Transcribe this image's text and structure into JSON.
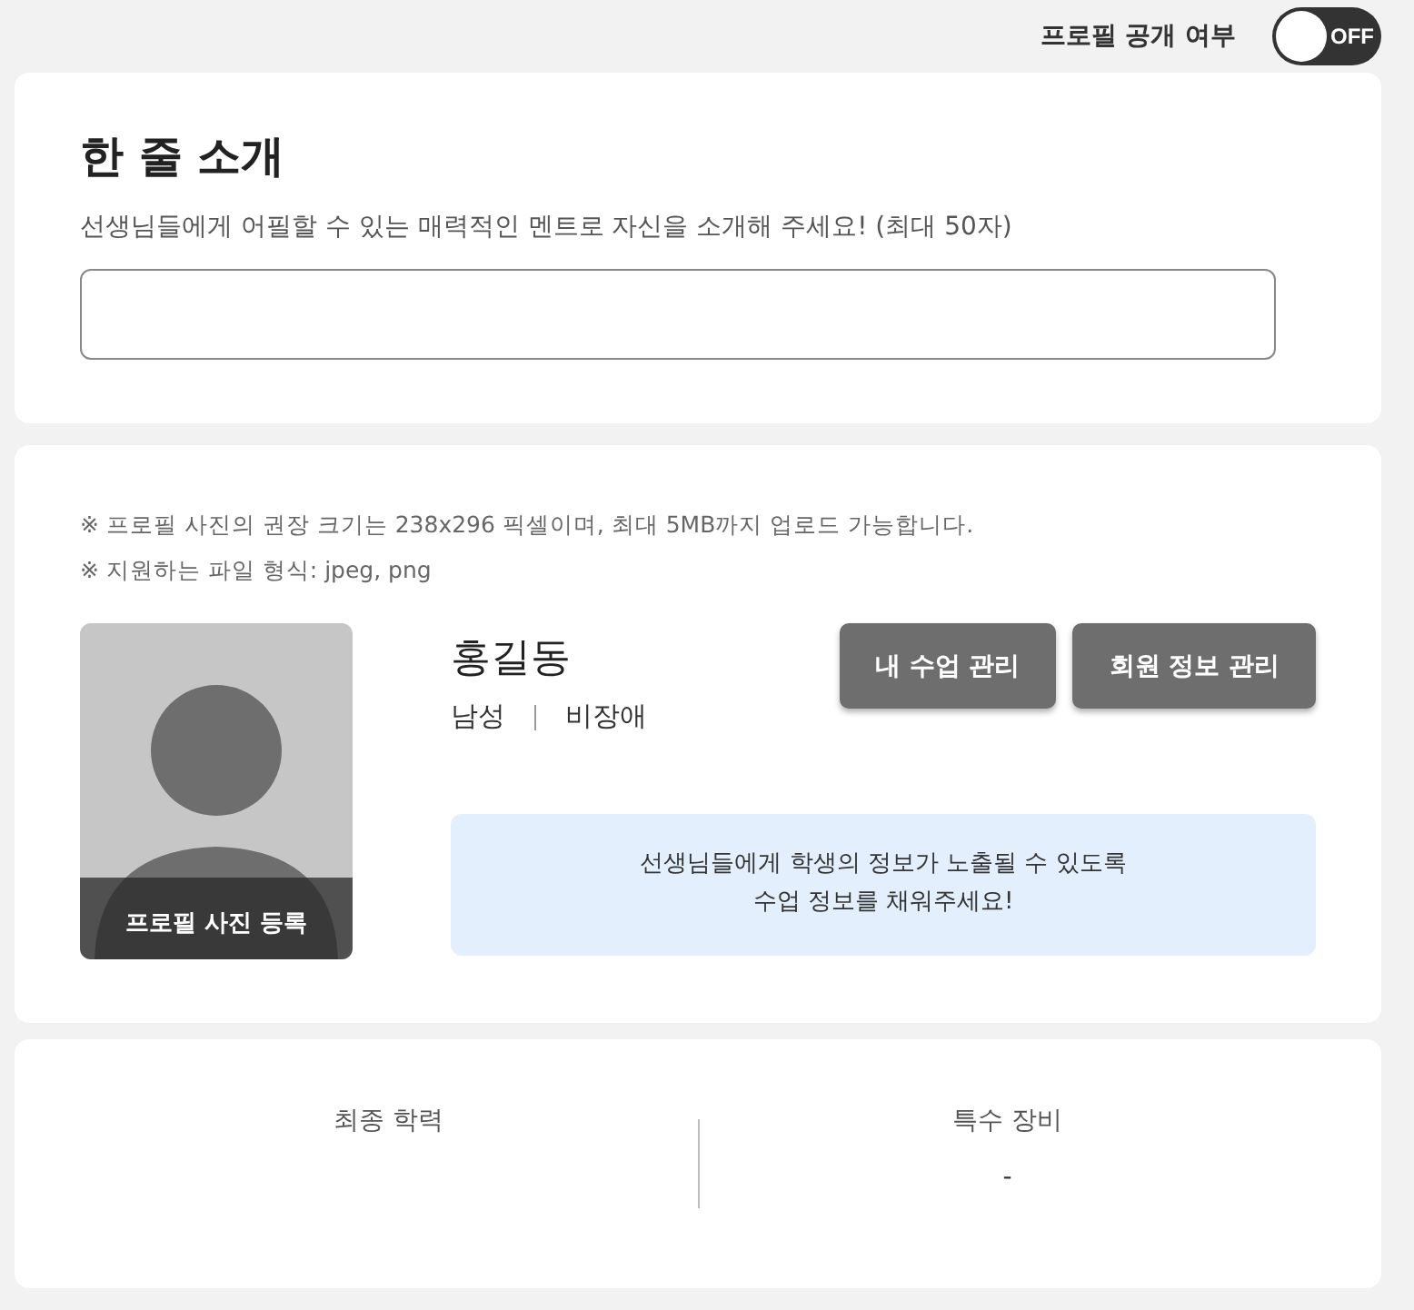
{
  "profile_visibility": {
    "label": "프로필 공개 여부",
    "toggle_text": "OFF",
    "on": false
  },
  "intro": {
    "title": "한 줄 소개",
    "description": "선생님들에게 어필할 수 있는 매력적인 멘트로 자신을 소개해 주세요! (최대 50자)"
  },
  "profile": {
    "notes": [
      "※ 프로필 사진의 권장 크기는 238x296 픽셀이며, 최대 5MB까지 업로드 가능합니다.",
      "※ 지원하는 파일 형식: jpeg, png"
    ],
    "photo_button": "프로필 사진 등록",
    "name": "홍길동",
    "gender": "남성",
    "disability": "비장애",
    "buttons": [
      "내 수업 관리",
      "회원 정보 관리"
    ],
    "notice_lines": [
      "선생님들에게 학생의 정보가 노출될 수 있도록",
      "수업 정보를 채워주세요!"
    ]
  },
  "info_columns": [
    {
      "label": "최종 학력"
    },
    {
      "label": "특수 장비",
      "value": "-"
    }
  ]
}
